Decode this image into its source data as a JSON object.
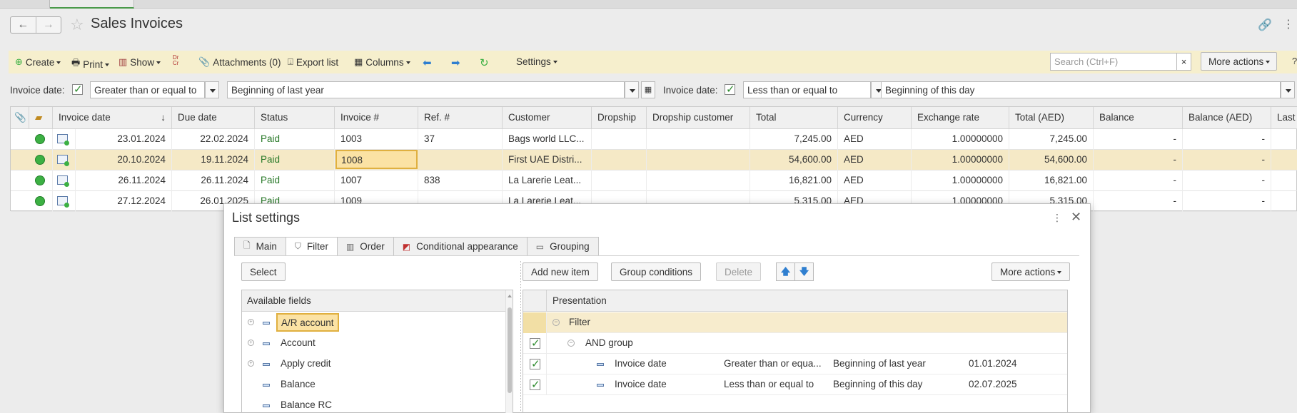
{
  "window": {
    "title": "Sales Invoices"
  },
  "toolbar": {
    "create": "Create",
    "print": "Print",
    "show": "Show",
    "drcr": "Dr Cr",
    "attachments": "Attachments (0)",
    "export": "Export list",
    "columns": "Columns",
    "settings": "Settings",
    "search_placeholder": "Search (Ctrl+F)",
    "search_clear": "×",
    "more_actions": "More actions",
    "help": "?"
  },
  "filters": [
    {
      "label": "Invoice date:",
      "checked": true,
      "condition": "Greater than or equal to",
      "value": "Beginning of last year"
    },
    {
      "label": "Invoice date:",
      "checked": true,
      "condition": "Less than or equal to",
      "value": "Beginning of this day"
    }
  ],
  "table": {
    "columns": [
      "Invoice date",
      "Due date",
      "Status",
      "Invoice #",
      "Ref. #",
      "Customer",
      "Dropship",
      "Dropship customer",
      "Total",
      "Currency",
      "Exchange rate",
      "Total (AED)",
      "Balance",
      "Balance (AED)",
      "Last"
    ],
    "sort_indicator": "↓",
    "rows": [
      {
        "invoice_date": "23.01.2024",
        "due_date": "22.02.2024",
        "status": "Paid",
        "invoice_no": "1003",
        "ref_no": "37",
        "customer": "Bags world LLC...",
        "dropship": "",
        "dropship_customer": "",
        "total": "7,245.00",
        "currency": "AED",
        "exchange_rate": "1.00000000",
        "total_aed": "7,245.00",
        "balance": "-",
        "balance_aed": "-"
      },
      {
        "invoice_date": "20.10.2024",
        "due_date": "19.11.2024",
        "status": "Paid",
        "invoice_no": "1008",
        "ref_no": "",
        "customer": "First UAE Distri...",
        "dropship": "",
        "dropship_customer": "",
        "total": "54,600.00",
        "currency": "AED",
        "exchange_rate": "1.00000000",
        "total_aed": "54,600.00",
        "balance": "-",
        "balance_aed": "-"
      },
      {
        "invoice_date": "26.11.2024",
        "due_date": "26.11.2024",
        "status": "Paid",
        "invoice_no": "1007",
        "ref_no": "838",
        "customer": "La Larerie Leat...",
        "dropship": "",
        "dropship_customer": "",
        "total": "16,821.00",
        "currency": "AED",
        "exchange_rate": "1.00000000",
        "total_aed": "16,821.00",
        "balance": "-",
        "balance_aed": "-"
      },
      {
        "invoice_date": "27.12.2024",
        "due_date": "26.01.2025",
        "status": "Paid",
        "invoice_no": "1009",
        "ref_no": "",
        "customer": "La Larerie Leat...",
        "dropship": "",
        "dropship_customer": "",
        "total": "5,315.00",
        "currency": "AED",
        "exchange_rate": "1.00000000",
        "total_aed": "5,315.00",
        "balance": "-",
        "balance_aed": "-"
      }
    ]
  },
  "dialog": {
    "title": "List settings",
    "tabs": [
      "Main",
      "Filter",
      "Order",
      "Conditional appearance",
      "Grouping"
    ],
    "active_tab": "Filter",
    "select_button": "Select",
    "add_item": "Add new item",
    "group_conditions": "Group conditions",
    "delete": "Delete",
    "more_actions": "More actions",
    "available_fields_header": "Available fields",
    "available_fields": [
      "A/R account",
      "Account",
      "Apply credit",
      "Balance",
      "Balance RC"
    ],
    "presentation_header": "Presentation",
    "filter_root": "Filter",
    "and_group": "AND group",
    "conditions": [
      {
        "field": "Invoice date",
        "operator": "Greater than or equa...",
        "value": "Beginning of last year",
        "date": "01.01.2024"
      },
      {
        "field": "Invoice date",
        "operator": "Less than or equal to",
        "value": "Beginning of this day",
        "date": "02.07.2025"
      }
    ]
  }
}
